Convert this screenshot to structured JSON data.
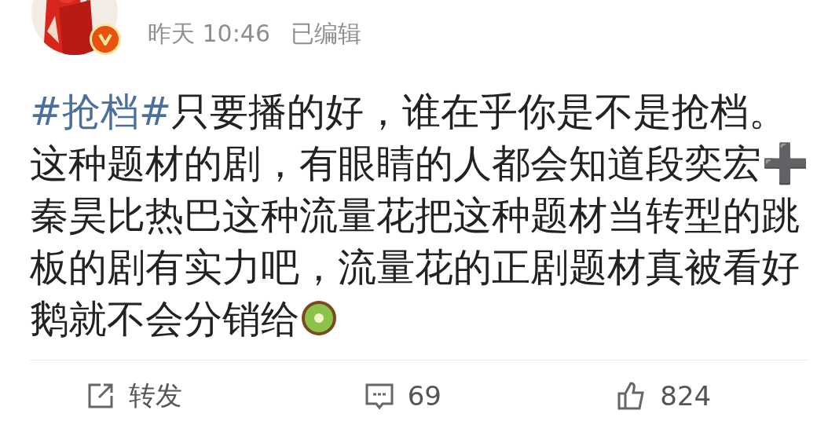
{
  "post": {
    "avatar": {
      "kind": "picture",
      "verified": true
    },
    "timestamp": "昨天 10:46",
    "edited": "已编辑",
    "hashtag": "#抢档#",
    "text": "只要播的好，谁在乎你是不是抢档。这种题材的剧，有眼睛的人都会知道段奕宏➕秦昊比热巴这种流量花把这种题材当转型的跳板的剧有实力吧，流量花的正剧题材真被看好鹅就不会分销给"
  },
  "actions": [
    {
      "kind": "repost",
      "label": "转发"
    },
    {
      "kind": "comment",
      "label": "69"
    },
    {
      "kind": "like",
      "label": "824"
    }
  ]
}
